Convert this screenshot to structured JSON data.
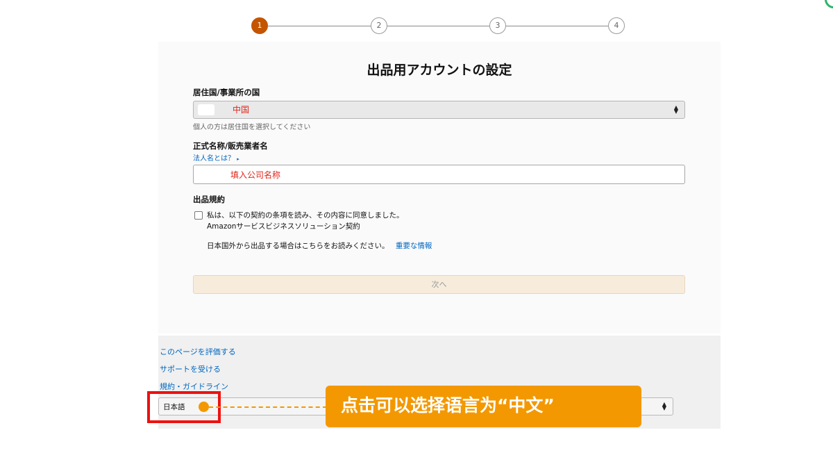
{
  "stepper": {
    "steps": [
      "1",
      "2",
      "3",
      "4"
    ],
    "active": "1"
  },
  "form": {
    "title": "出品用アカウントの設定",
    "country": {
      "label": "居住国/事業所の国",
      "value": "中国",
      "hint": "個人の方は居住国を選択してください"
    },
    "name": {
      "label": "正式名称/販売業者名",
      "help_link": "法人名とは？",
      "placeholder_note": "填入公司名称"
    },
    "terms": {
      "label": "出品規約",
      "agree_text": "私は、以下の契約の条項を読み、その内容に同意しました。",
      "agreement_link": "Amazonサービスビジネスソリューション契約",
      "overseas_text": "日本国外から出品する場合はこちらをお読みください。",
      "important_link": "重要な情報"
    },
    "next_button": "次へ"
  },
  "footer": {
    "links": [
      "このページを評価する",
      "サポートを受ける",
      "規約・ガイドライン"
    ],
    "language_value": "日本語"
  },
  "annotation": {
    "callout_text": "点击可以选择语言为“中文”"
  },
  "colors": {
    "accent": "#c45500",
    "callout": "#f39800",
    "highlight": "#ee1111",
    "link": "#0066c0"
  }
}
